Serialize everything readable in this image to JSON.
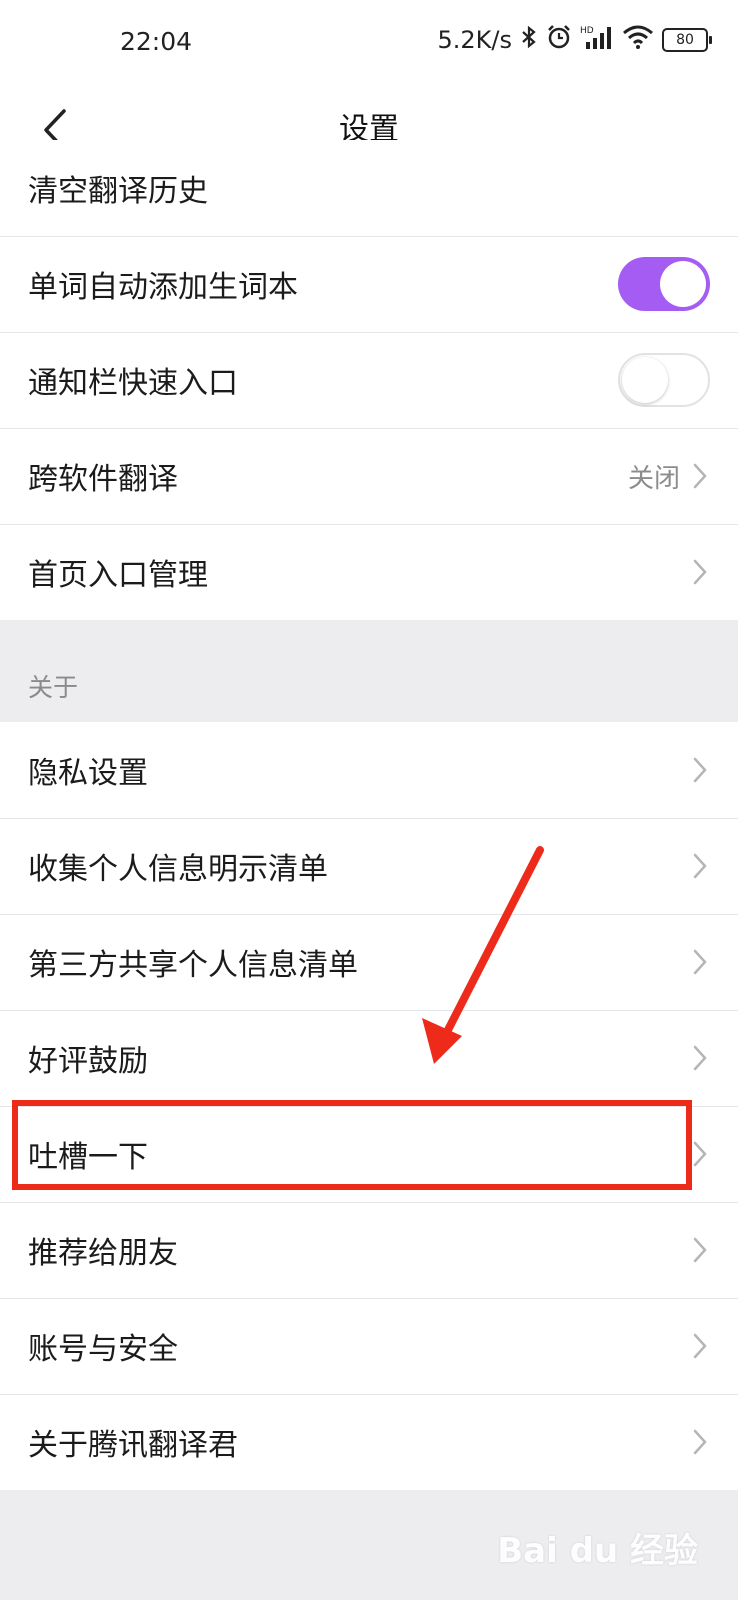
{
  "status_bar": {
    "time": "22:04",
    "speed": "5.2K/s",
    "battery": "80",
    "icons": [
      "bluetooth-icon",
      "alarm-icon",
      "hd-signal-icon",
      "wifi-icon",
      "battery-icon"
    ]
  },
  "header": {
    "title": "设置",
    "back_icon": "chevron-left-icon"
  },
  "settings_group": [
    {
      "label": "清空翻译历史"
    },
    {
      "label": "单词自动添加生词本",
      "toggle": "on"
    },
    {
      "label": "通知栏快速入口",
      "toggle": "off"
    },
    {
      "label": "跨软件翻译",
      "value": "关闭"
    },
    {
      "label": "首页入口管理"
    }
  ],
  "about_section": {
    "title": "关于",
    "items": [
      {
        "label": "隐私设置"
      },
      {
        "label": "收集个人信息明示清单"
      },
      {
        "label": "第三方共享个人信息清单"
      },
      {
        "label": "好评鼓励"
      },
      {
        "label": "吐槽一下"
      },
      {
        "label": "推荐给朋友"
      },
      {
        "label": "账号与安全"
      },
      {
        "label": "关于腾讯翻译君"
      }
    ]
  },
  "colors": {
    "toggle_on": "#a45cf2",
    "annotation_red": "#ee2a1a",
    "page_background": "#ededf0"
  },
  "watermark": "Bai du 经验"
}
